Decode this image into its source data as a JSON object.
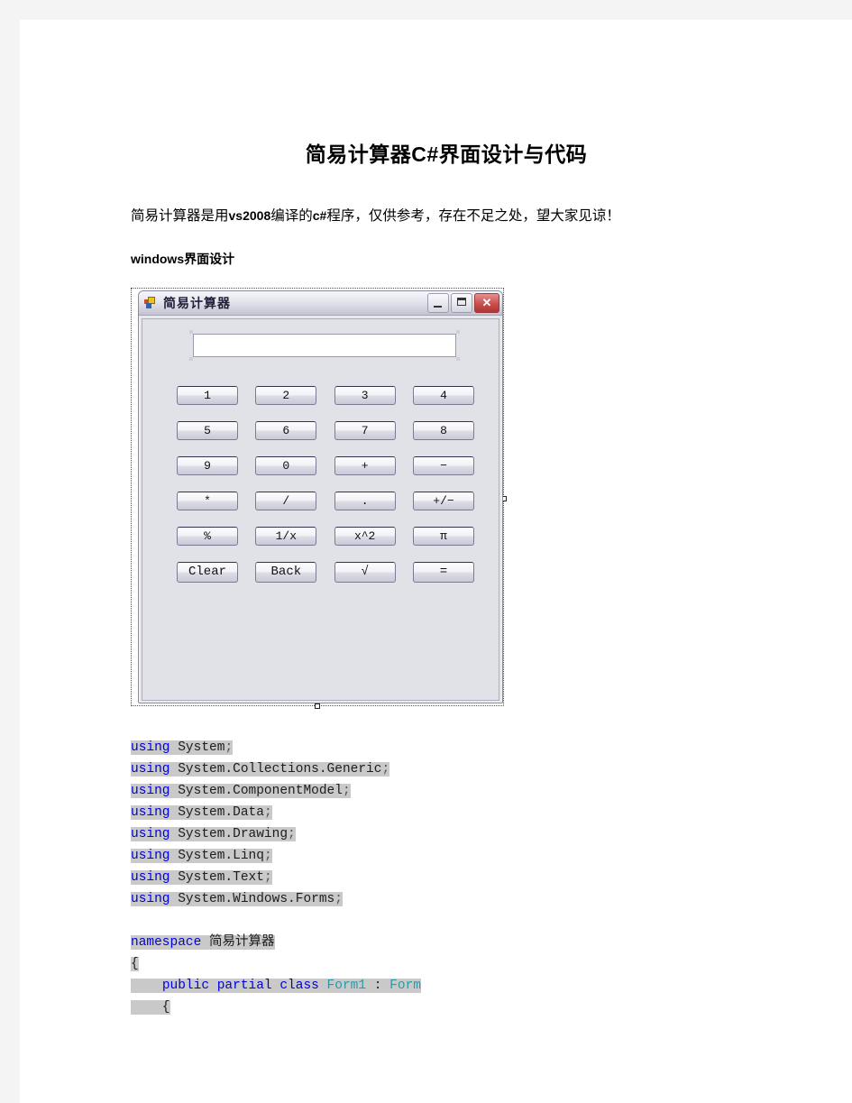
{
  "document": {
    "title": "简易计算器C#界面设计与代码",
    "intro_paragraph": {
      "pre": "简易计算器是用",
      "bold": "vs2008",
      "mid": "编译的",
      "bold2": "c#",
      "post": "程序，仅供参考，存在不足之处，望大家见谅！"
    },
    "section_label": "windows界面设计"
  },
  "calculator": {
    "window_title": "简易计算器",
    "icon_name": "app-form-icon",
    "titlebar_buttons": [
      {
        "name": "minimize-button",
        "glyph": "_"
      },
      {
        "name": "maximize-button",
        "glyph": "□"
      },
      {
        "name": "close-button",
        "glyph": "✕"
      }
    ],
    "display_value": "",
    "display_placeholder": "",
    "keypad_rows": [
      [
        "1",
        "2",
        "3",
        "4"
      ],
      [
        "5",
        "6",
        "7",
        "8"
      ],
      [
        "9",
        "0",
        "+",
        "−"
      ],
      [
        "*",
        "/",
        ".",
        "+/−"
      ],
      [
        "%",
        "1/x",
        "x^2",
        "π"
      ],
      [
        "Clear",
        "Back",
        "√",
        "="
      ]
    ]
  },
  "code": {
    "lines": [
      {
        "tokens": [
          {
            "t": "using",
            "c": "kw"
          },
          {
            "t": " System",
            "c": ""
          },
          {
            "t": ";",
            "c": "pun"
          }
        ]
      },
      {
        "tokens": [
          {
            "t": "using",
            "c": "kw"
          },
          {
            "t": " System.Collections.Generic",
            "c": ""
          },
          {
            "t": ";",
            "c": "pun"
          }
        ]
      },
      {
        "tokens": [
          {
            "t": "using",
            "c": "kw"
          },
          {
            "t": " System.ComponentModel",
            "c": ""
          },
          {
            "t": ";",
            "c": "pun"
          }
        ]
      },
      {
        "tokens": [
          {
            "t": "using",
            "c": "kw"
          },
          {
            "t": " System.Data",
            "c": ""
          },
          {
            "t": ";",
            "c": "pun"
          }
        ]
      },
      {
        "tokens": [
          {
            "t": "using",
            "c": "kw"
          },
          {
            "t": " System.Drawing",
            "c": ""
          },
          {
            "t": ";",
            "c": "pun"
          }
        ]
      },
      {
        "tokens": [
          {
            "t": "using",
            "c": "kw"
          },
          {
            "t": " System.Linq",
            "c": ""
          },
          {
            "t": ";",
            "c": "pun"
          }
        ]
      },
      {
        "tokens": [
          {
            "t": "using",
            "c": "kw"
          },
          {
            "t": " System.Text",
            "c": ""
          },
          {
            "t": ";",
            "c": "pun"
          }
        ]
      },
      {
        "tokens": [
          {
            "t": "using",
            "c": "kw"
          },
          {
            "t": " System.Windows.Forms",
            "c": ""
          },
          {
            "t": ";",
            "c": "pun"
          }
        ]
      },
      {
        "tokens": []
      },
      {
        "tokens": [
          {
            "t": "namespace",
            "c": "kw"
          },
          {
            "t": " 简易计算器",
            "c": ""
          }
        ]
      },
      {
        "tokens": [
          {
            "t": "{",
            "c": ""
          }
        ]
      },
      {
        "tokens": [
          {
            "t": "    ",
            "c": ""
          },
          {
            "t": "public partial class",
            "c": "kw"
          },
          {
            "t": " ",
            "c": ""
          },
          {
            "t": "Form1",
            "c": "typ"
          },
          {
            "t": " : ",
            "c": ""
          },
          {
            "t": "Form",
            "c": "typ"
          }
        ]
      },
      {
        "tokens": [
          {
            "t": "    {",
            "c": ""
          }
        ]
      }
    ]
  }
}
